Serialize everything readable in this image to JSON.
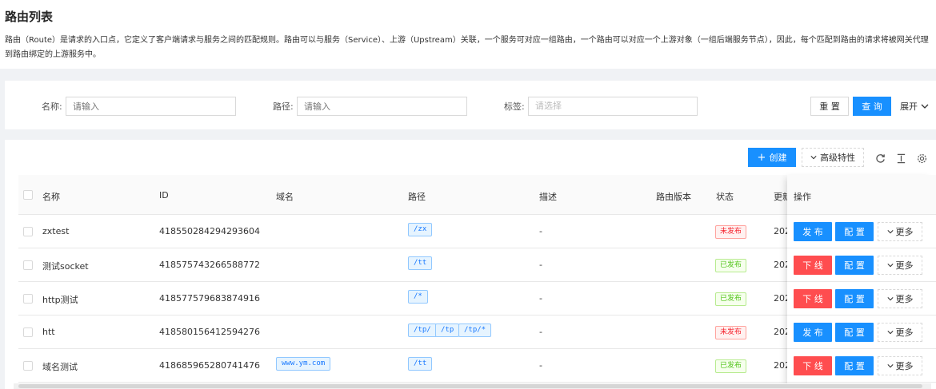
{
  "header": {
    "title": "路由列表",
    "description": "路由（Route）是请求的入口点，它定义了客户端请求与服务之间的匹配规则。路由可以与服务（Service）、上游（Upstream）关联，一个服务可对应一组路由，一个路由可以对应一个上游对象（一组后端服务节点），因此，每个匹配到路由的请求将被网关代理到路由绑定的上游服务中。"
  },
  "filters": {
    "name_label": "名称:",
    "name_placeholder": "请输入",
    "path_label": "路径:",
    "path_placeholder": "请输入",
    "tag_label": "标签:",
    "tag_placeholder": "请选择",
    "reset_label": "重 置",
    "query_label": "查 询",
    "expand_label": "展开"
  },
  "toolbar": {
    "create_label": "创建",
    "advanced_label": "高级特性"
  },
  "table": {
    "columns": {
      "name": "名称",
      "id": "ID",
      "domain": "域名",
      "path": "路径",
      "desc": "描述",
      "version": "路由版本",
      "status": "状态",
      "updated": "更新",
      "ops": "操作"
    },
    "rows": [
      {
        "name": "zxtest",
        "id": "418550284294293604",
        "domain": "",
        "paths": [
          "/zx"
        ],
        "desc": "-",
        "status": "未发布",
        "updated": "202",
        "op1": "发 布",
        "op2": "配 置",
        "more": "更多"
      },
      {
        "name": "测试socket",
        "id": "418575743266588772",
        "domain": "",
        "paths": [
          "/tt"
        ],
        "desc": "-",
        "status": "已发布",
        "updated": "202",
        "op1": "下 线",
        "op2": "配 置",
        "more": "更多"
      },
      {
        "name": "http测试",
        "id": "418577579683874916",
        "domain": "",
        "paths": [
          "/*"
        ],
        "desc": "-",
        "status": "已发布",
        "updated": "202",
        "op1": "下 线",
        "op2": "配 置",
        "more": "更多"
      },
      {
        "name": "htt",
        "id": "418580156412594276",
        "domain": "",
        "paths": [
          "/tp/",
          "/tp",
          "/tp/*"
        ],
        "desc": "-",
        "status": "未发布",
        "updated": "202",
        "op1": "发 布",
        "op2": "配 置",
        "more": "更多"
      },
      {
        "name": "域名测试",
        "id": "418685965280741476",
        "domain": "www.ym.com",
        "paths": [
          "/tt"
        ],
        "desc": "-",
        "status": "已发布",
        "updated": "202",
        "op1": "下 线",
        "op2": "配 置",
        "more": "更多"
      }
    ]
  },
  "colors": {
    "primary": "#1890ff",
    "danger": "#ff4d4f",
    "success": "#52c41a"
  },
  "icons": [
    "plus-icon",
    "chevron-down-icon",
    "reload-icon",
    "column-height-icon",
    "settings-icon"
  ]
}
